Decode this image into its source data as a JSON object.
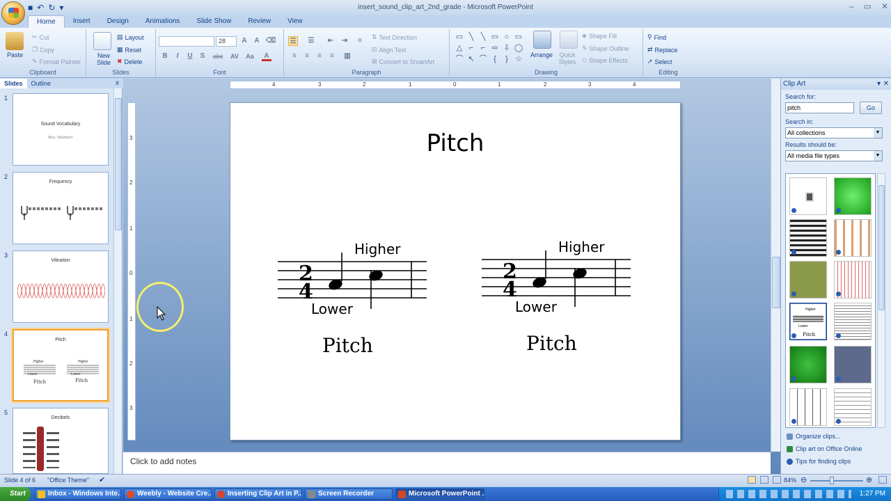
{
  "window": {
    "title": "insert_sound_clip_art_2nd_grade - Microsoft PowerPoint",
    "controls": [
      "–",
      "▭",
      "✕"
    ]
  },
  "ribbon_tabs": [
    "Home",
    "Insert",
    "Design",
    "Animations",
    "Slide Show",
    "Review",
    "View"
  ],
  "ribbon": {
    "clipboard": {
      "paste": "Paste",
      "cut": "Cut",
      "copy": "Copy",
      "format_painter": "Format Painter",
      "label": "Clipboard"
    },
    "slides": {
      "new_slide": "New Slide",
      "layout": "Layout",
      "reset": "Reset",
      "delete": "Delete",
      "label": "Slides"
    },
    "font": {
      "font_size": "28",
      "label": "Font",
      "bold": "B",
      "italic": "I",
      "underline": "U",
      "shadow": "S",
      "strike": "abc",
      "spacing": "AV",
      "case": "Aa",
      "color": "A"
    },
    "paragraph": {
      "text_direction": "Text Direction",
      "align_text": "Align Text",
      "convert_smartart": "Convert to SmartArt",
      "label": "Paragraph"
    },
    "drawing": {
      "arrange": "Arrange",
      "quick_styles": "Quick Styles",
      "shape_fill": "Shape Fill",
      "shape_outline": "Shape Outline",
      "shape_effects": "Shape Effects",
      "label": "Drawing",
      "shapes": [
        "▭",
        "╲",
        "╲",
        "▭",
        "○",
        "▭",
        "△",
        "⌐",
        "⌐",
        "⇨",
        "⇩",
        "◯",
        "⌒",
        "↖",
        "⌒",
        "{",
        "}",
        "☆"
      ]
    },
    "editing": {
      "find": "Find",
      "replace": "Replace",
      "select": "Select",
      "label": "Editing"
    }
  },
  "left_pane": {
    "tabs": [
      "Slides",
      "Outline"
    ],
    "close": "x",
    "slides": [
      {
        "num": "1",
        "title": "Sound Vocabulary",
        "subtitle": "Miss. Washburn"
      },
      {
        "num": "2",
        "title": "Frequency"
      },
      {
        "num": "3",
        "title": "Vibration"
      },
      {
        "num": "4",
        "title": "Pitch",
        "sub_left": "Pitch",
        "sub_right": "Pitch",
        "higher": "Higher",
        "lower": "Lower"
      },
      {
        "num": "5",
        "title": "Decibels"
      }
    ]
  },
  "slide": {
    "title": "Pitch",
    "left": {
      "higher": "Higher",
      "lower": "Lower",
      "caption": "Pitch"
    },
    "right": {
      "higher": "Higher",
      "lower": "Lower",
      "caption": "Pitch"
    }
  },
  "ruler": {
    "horizontal": [
      "4",
      "3",
      "2",
      "1",
      "0",
      "1",
      "2",
      "3",
      "4"
    ],
    "vertical": [
      "3",
      "2",
      "1",
      "0",
      "1",
      "2",
      "3"
    ]
  },
  "notes_placeholder": "Click to add notes",
  "clip_art": {
    "title": "Clip Art",
    "search_for_label": "Search for:",
    "search_value": "pitch",
    "go": "Go",
    "search_in_label": "Search in:",
    "search_in_value": "All collections",
    "results_label": "Results should be:",
    "results_value": "All media file types",
    "links": [
      "Organize clips...",
      "Clip art on Office Online",
      "Tips for finding clips"
    ],
    "selected_clip": {
      "higher": "Higher",
      "lower": "Lower",
      "caption": "Pitch"
    }
  },
  "status": {
    "slide_of": "Slide 4 of 6",
    "theme": "\"Office Theme\"",
    "zoom": "84%"
  },
  "taskbar": {
    "start": "Start",
    "tasks": [
      "Inbox - Windows Inte...",
      "Weebly - Website Cre...",
      "Inserting Clip Art in P...",
      "Screen Recorder",
      "Microsoft PowerPoint ..."
    ],
    "time": "1:27 PM"
  },
  "colors": {
    "accent": "#15428b",
    "selected_thumb": "#f0a035",
    "highlight_ring": "#f5f06a"
  }
}
